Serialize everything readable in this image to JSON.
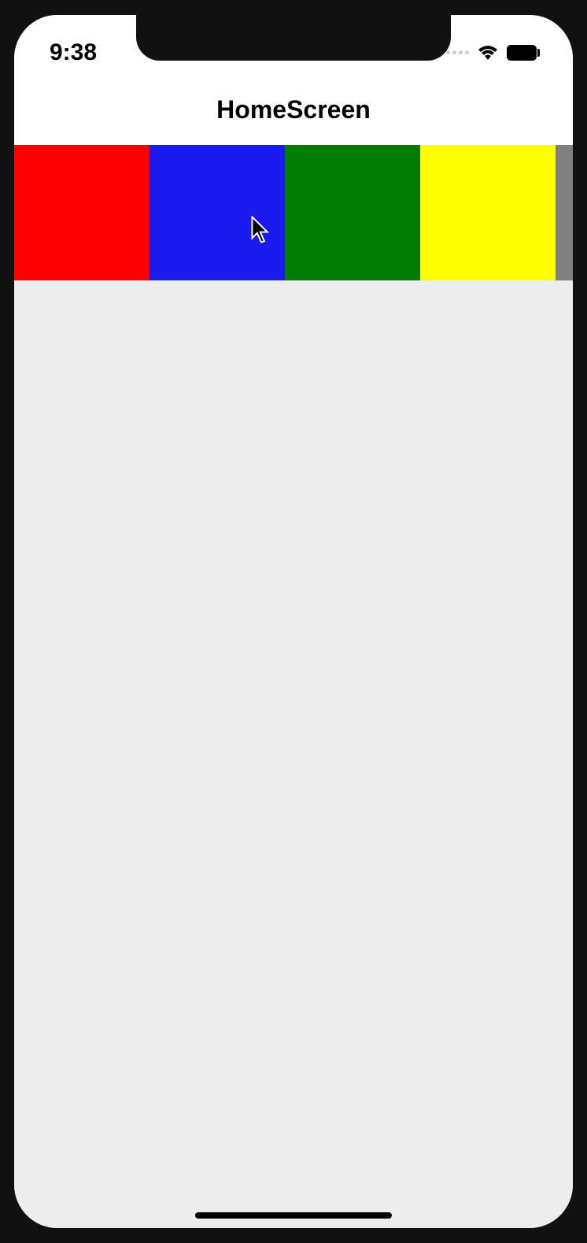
{
  "status_bar": {
    "time": "9:38"
  },
  "nav": {
    "title": "HomeScreen"
  },
  "tiles": [
    {
      "color": "#ff0000",
      "name": "red"
    },
    {
      "color": "#1a1aef",
      "name": "blue"
    },
    {
      "color": "#007d00",
      "name": "green"
    },
    {
      "color": "#ffff00",
      "name": "yellow"
    },
    {
      "color": "#808080",
      "name": "gray"
    }
  ]
}
